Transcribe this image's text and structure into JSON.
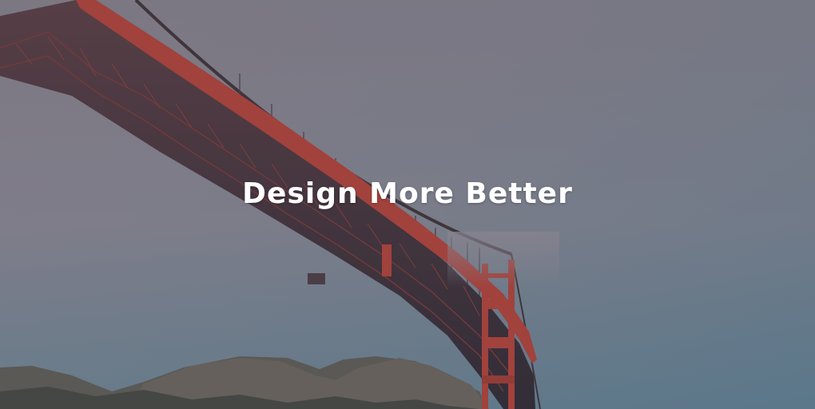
{
  "hero": {
    "headline": "Design More Better",
    "image_subject": "golden-gate-bridge",
    "colors": {
      "sky_top": "#87858e",
      "sky_bottom": "#6f8a9a",
      "bridge_red": "#b5443a",
      "bridge_shadow": "#3d2c33",
      "headline_text": "#ffffff"
    }
  }
}
